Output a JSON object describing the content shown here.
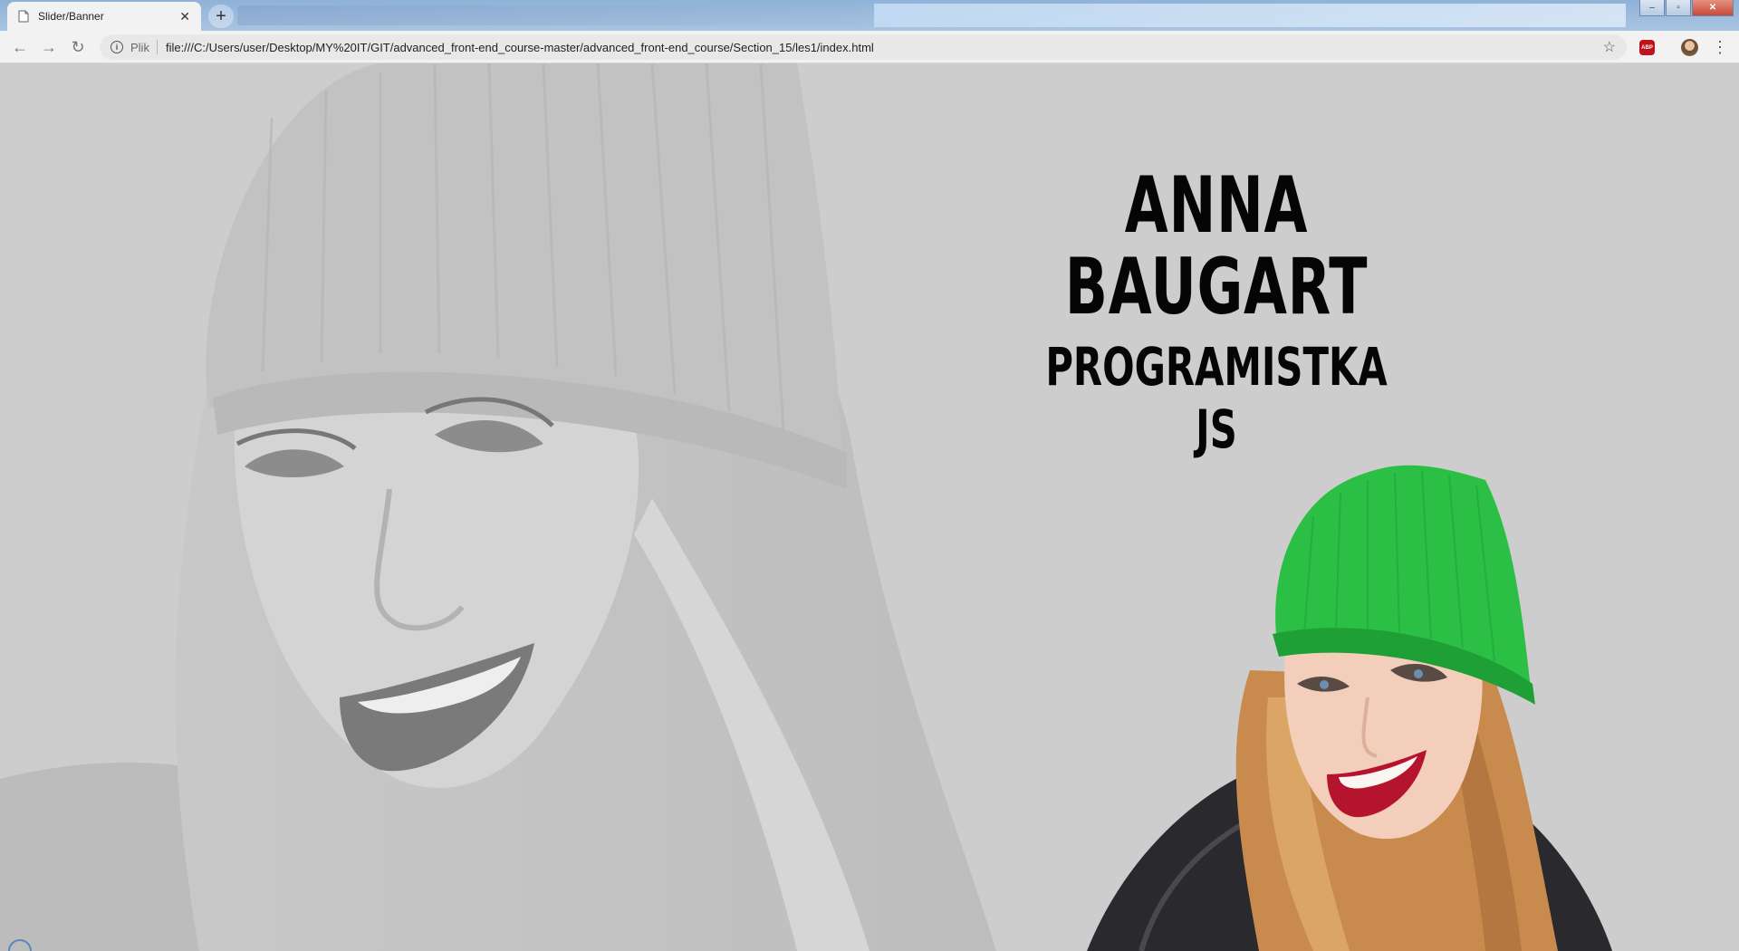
{
  "browser": {
    "tab": {
      "title": "Slider/Banner"
    },
    "new_tab_symbol": "+",
    "window_controls": {
      "minimize": "–",
      "maximize": "▫",
      "close": "✕"
    },
    "address_bar": {
      "scheme_label": "Plik",
      "url": "file:///C:/Users/user/Desktop/MY%20IT/GIT/advanced_front-end_course-master/advanced_front-end_course/Section_15/les1/index.html"
    },
    "extensions": {
      "adblock_label": "ABP"
    },
    "icons": [
      "page-icon",
      "close-icon",
      "plus-icon",
      "back-arrow-icon",
      "forward-arrow-icon",
      "reload-icon",
      "info-icon",
      "star-icon",
      "adblock-icon",
      "avatar",
      "menu-icon"
    ]
  },
  "page": {
    "name": "ANNA BAUGART",
    "role": "PROGRAMISTKA JS"
  },
  "colors": {
    "page_background": "#cdcdcd",
    "headline": "#050505",
    "beanie": "#2bbf45",
    "chrome": "#f2f2f2"
  }
}
